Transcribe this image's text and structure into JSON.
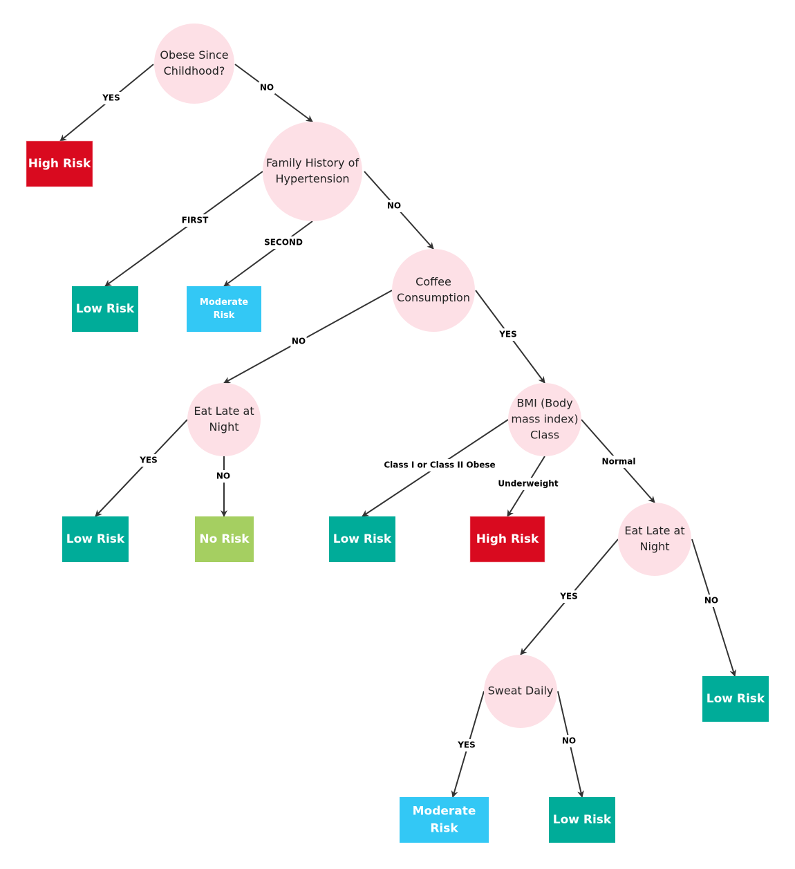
{
  "colors": {
    "decision": "#fde0e6",
    "high": "#d90a1f",
    "low": "#00ac99",
    "moderate": "#33c8f5",
    "none": "#a5cf61",
    "edge": "#333333"
  },
  "nodes": [
    {
      "id": "n1",
      "type": "decision",
      "lines": [
        "Obese Since",
        "Childhood?"
      ]
    },
    {
      "id": "n2",
      "type": "decision",
      "lines": [
        "Family History of",
        "Hypertension"
      ]
    },
    {
      "id": "n3",
      "type": "decision",
      "lines": [
        "Coffee",
        "Consumption"
      ]
    },
    {
      "id": "n4",
      "type": "decision",
      "lines": [
        "Eat Late at",
        "Night"
      ]
    },
    {
      "id": "n5",
      "type": "decision",
      "lines": [
        "BMI (Body",
        "mass index)",
        "Class"
      ]
    },
    {
      "id": "n6",
      "type": "decision",
      "lines": [
        "Eat Late at",
        "Night"
      ]
    },
    {
      "id": "n7",
      "type": "decision",
      "lines": [
        "Sweat Daily"
      ]
    },
    {
      "id": "r1",
      "type": "high",
      "lines": [
        "High Risk"
      ]
    },
    {
      "id": "r2",
      "type": "low",
      "lines": [
        "Low Risk"
      ]
    },
    {
      "id": "r3",
      "type": "moderate",
      "lines": [
        "Moderate",
        "Risk"
      ]
    },
    {
      "id": "r4",
      "type": "low",
      "lines": [
        "Low Risk"
      ]
    },
    {
      "id": "r5",
      "type": "none",
      "lines": [
        "No Risk"
      ]
    },
    {
      "id": "r6",
      "type": "low",
      "lines": [
        "Low Risk"
      ]
    },
    {
      "id": "r7",
      "type": "high",
      "lines": [
        "High Risk"
      ]
    },
    {
      "id": "r8",
      "type": "low",
      "lines": [
        "Low Risk"
      ]
    },
    {
      "id": "r9",
      "type": "moderate",
      "lines": [
        "Moderate",
        "Risk"
      ]
    },
    {
      "id": "r10",
      "type": "low",
      "lines": [
        "Low Risk"
      ]
    }
  ],
  "edges": [
    {
      "from": "n1",
      "to": "r1",
      "label": "YES"
    },
    {
      "from": "n1",
      "to": "n2",
      "label": "NO"
    },
    {
      "from": "n2",
      "to": "r2",
      "label": "FIRST"
    },
    {
      "from": "n2",
      "to": "r3",
      "label": "SECOND"
    },
    {
      "from": "n2",
      "to": "n3",
      "label": "NO"
    },
    {
      "from": "n3",
      "to": "n4",
      "label": "NO"
    },
    {
      "from": "n3",
      "to": "n5",
      "label": "YES"
    },
    {
      "from": "n4",
      "to": "r4",
      "label": "YES"
    },
    {
      "from": "n4",
      "to": "r5",
      "label": "NO"
    },
    {
      "from": "n5",
      "to": "r6",
      "label": "Class I or Class II Obese"
    },
    {
      "from": "n5",
      "to": "r7",
      "label": "Underweight"
    },
    {
      "from": "n5",
      "to": "n6",
      "label": "Normal"
    },
    {
      "from": "n6",
      "to": "n7",
      "label": "YES"
    },
    {
      "from": "n6",
      "to": "r8",
      "label": "NO"
    },
    {
      "from": "n7",
      "to": "r9",
      "label": "YES"
    },
    {
      "from": "n7",
      "to": "r10",
      "label": "NO"
    }
  ]
}
